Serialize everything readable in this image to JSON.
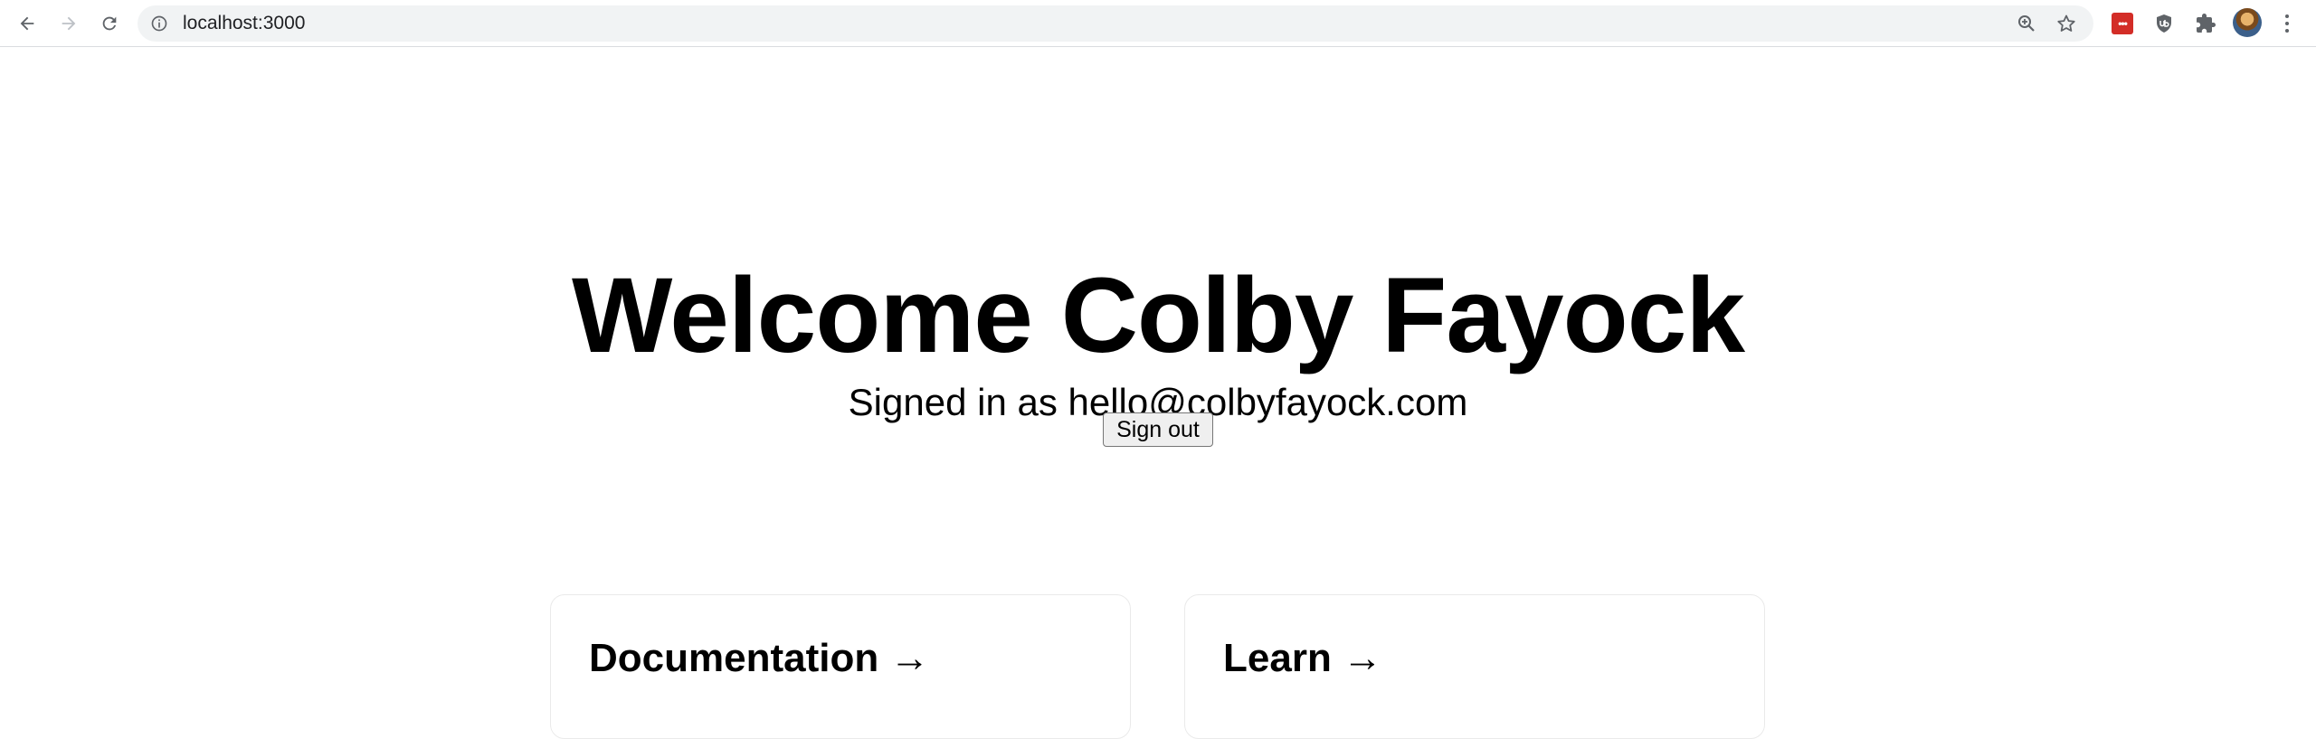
{
  "browser": {
    "url": "localhost:3000",
    "icons": {
      "back": "arrow-left-icon",
      "forward": "arrow-right-icon",
      "reload": "reload-icon",
      "info": "info-icon",
      "zoom": "zoom-in-icon",
      "bookmark": "star-icon",
      "extensions": [
        "lastpass-icon",
        "ublock-icon",
        "puzzle-icon"
      ],
      "menu": "more-vertical-icon"
    },
    "lastpass_label": "•••"
  },
  "page": {
    "title": "Welcome Colby Fayock",
    "subtitle": "Signed in as hello@colbyfayock.com",
    "signout_label": "Sign out",
    "cards": [
      {
        "title": "Documentation →"
      },
      {
        "title": "Learn →"
      }
    ]
  },
  "colors": {
    "chrome_bg": "#ffffff",
    "omnibox_bg": "#f1f3f4",
    "lastpass_red": "#d32d27",
    "card_border": "#eaeaea"
  }
}
